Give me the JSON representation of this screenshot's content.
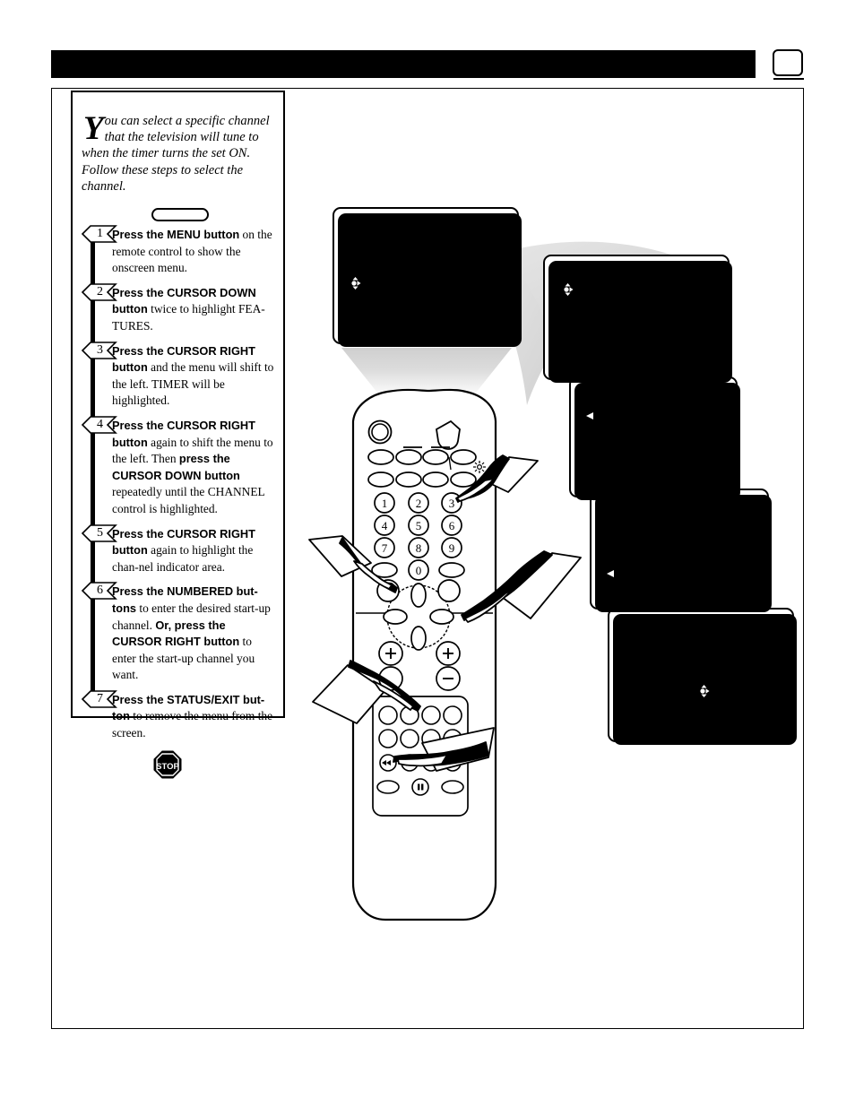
{
  "header": {
    "bar_color": "#000000",
    "title": "",
    "page_number": ""
  },
  "instructions": {
    "intro_dropcap": "Y",
    "intro_text": "ou can select a specific channel that the television will tune to when the timer turns the set ON. Follow these steps to select the channel.",
    "button_pill_label": "",
    "steps": [
      {
        "number": "1",
        "segments": [
          {
            "text": "Press the MENU button",
            "bold": true
          },
          {
            "text": " on the remote control to show the onscreen menu.",
            "bold": false
          }
        ]
      },
      {
        "number": "2",
        "segments": [
          {
            "text": "Press the CURSOR DOWN button",
            "bold": true
          },
          {
            "text": " twice to highlight FEA-TURES.",
            "bold": false
          }
        ]
      },
      {
        "number": "3",
        "segments": [
          {
            "text": "Press the CURSOR RIGHT button",
            "bold": true
          },
          {
            "text": " and the menu will shift to the left. TIMER will be highlighted.",
            "bold": false
          }
        ]
      },
      {
        "number": "4",
        "segments": [
          {
            "text": "Press the CURSOR RIGHT button",
            "bold": true
          },
          {
            "text": " again to shift the menu to the left. Then ",
            "bold": false
          },
          {
            "text": "press the CURSOR DOWN button",
            "bold": true
          },
          {
            "text": " repeatedly until the CHANNEL control is highlighted.",
            "bold": false
          }
        ]
      },
      {
        "number": "5",
        "segments": [
          {
            "text": "Press the CURSOR RIGHT button",
            "bold": true
          },
          {
            "text": " again to highlight the chan-nel indicator area.",
            "bold": false
          }
        ]
      },
      {
        "number": "6",
        "segments": [
          {
            "text": "Press the NUMBERED but-tons",
            "bold": true
          },
          {
            "text": " to enter the desired start-up channel.  ",
            "bold": false
          },
          {
            "text": "Or, press the CURSOR RIGHT button",
            "bold": true
          },
          {
            "text": " to enter the start-up channel you want.",
            "bold": false
          }
        ]
      },
      {
        "number": "7",
        "segments": [
          {
            "text": "Press the STATUS/EXIT but-ton",
            "bold": true
          },
          {
            "text": " to remove the menu from the screen.",
            "bold": false
          }
        ]
      }
    ],
    "stop_sign_label": "STOP"
  },
  "tv_screens": [
    {
      "id": "screen-1-main-menu",
      "items": [
        {
          "label": "",
          "highlighted": false,
          "cursor": ""
        },
        {
          "label": "",
          "highlighted": false,
          "cursor": ""
        },
        {
          "label": "",
          "highlighted": true,
          "cursor": "four-way"
        },
        {
          "label": "",
          "highlighted": false,
          "cursor": ""
        }
      ],
      "side_arrows": false
    },
    {
      "id": "screen-2-features-menu",
      "items": [
        {
          "label": "",
          "highlighted": true,
          "cursor": "four-way"
        },
        {
          "label": "",
          "highlighted": false,
          "cursor": ""
        },
        {
          "label": "",
          "highlighted": false,
          "cursor": ""
        },
        {
          "label": "",
          "highlighted": false,
          "cursor": ""
        },
        {
          "label": "",
          "highlighted": false,
          "cursor": ""
        }
      ],
      "side_arrows": false
    },
    {
      "id": "screen-3-timer-menu",
      "items": [
        {
          "label": "",
          "highlighted": true,
          "cursor": "left"
        },
        {
          "label": "",
          "highlighted": false,
          "cursor": ""
        },
        {
          "label": "",
          "highlighted": false,
          "cursor": ""
        },
        {
          "label": "",
          "highlighted": false,
          "cursor": ""
        },
        {
          "label": "",
          "highlighted": false,
          "cursor": ""
        },
        {
          "label": "",
          "highlighted": false,
          "cursor": ""
        }
      ],
      "side_arrows": true
    },
    {
      "id": "screen-4-channel-control",
      "items": [
        {
          "label": "",
          "highlighted": false,
          "cursor": ""
        },
        {
          "label": "",
          "highlighted": false,
          "cursor": ""
        },
        {
          "label": "",
          "highlighted": false,
          "cursor": ""
        },
        {
          "label": "",
          "highlighted": true,
          "cursor": "left"
        },
        {
          "label": "",
          "highlighted": false,
          "cursor": ""
        },
        {
          "label": "",
          "highlighted": false,
          "cursor": ""
        }
      ],
      "side_arrows": true
    },
    {
      "id": "screen-5-channel-indicator",
      "items": [
        {
          "label": "",
          "highlighted": false,
          "cursor": ""
        },
        {
          "label": "",
          "highlighted": false,
          "cursor": ""
        },
        {
          "label": "",
          "highlighted": false,
          "cursor": ""
        },
        {
          "label": "",
          "highlighted": false,
          "cursor": "left"
        },
        {
          "label": "",
          "highlighted": false,
          "cursor": ""
        },
        {
          "label": "",
          "highlighted": false,
          "cursor": ""
        }
      ],
      "side_arrows": true,
      "right_highlight": true
    }
  ],
  "remote": {
    "name": "remote-control",
    "keypad": [
      "1",
      "2",
      "3",
      "4",
      "5",
      "6",
      "7",
      "8",
      "9",
      "0"
    ],
    "volume_up": "+",
    "channel_up": "+",
    "channel_down": "−",
    "transport": [
      "rewind",
      "stop",
      "play",
      "fast-forward",
      "pause"
    ],
    "pointer_count": 4
  },
  "colors": {
    "ink": "#000000",
    "paper": "#ffffff",
    "beam_gray": "#d8d8d8",
    "swoosh_gray": "#d5d5d5"
  }
}
